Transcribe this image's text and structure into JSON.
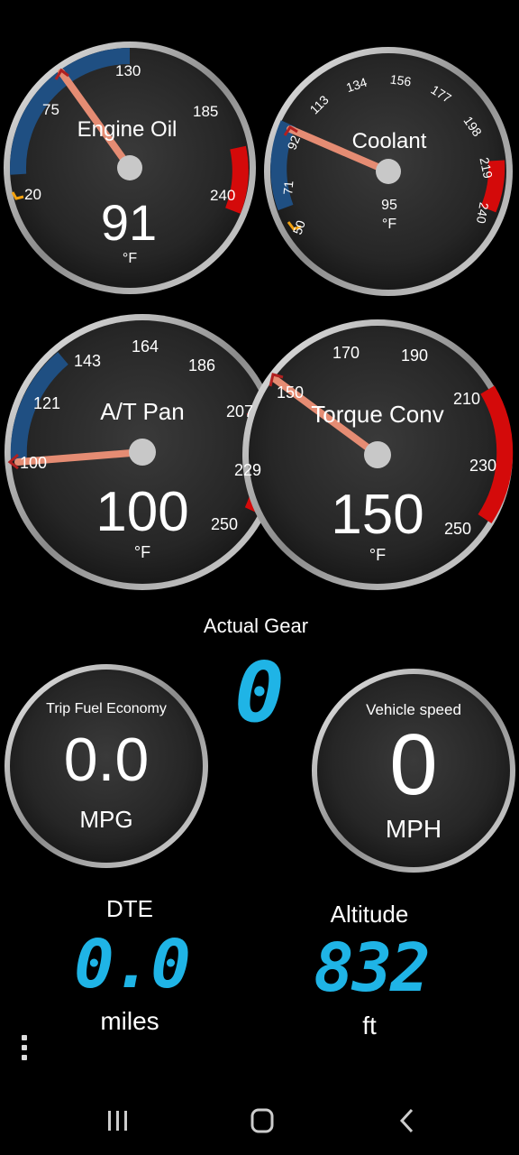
{
  "colors": {
    "accent_blue": "#1fb4e6",
    "band_blue": "#1f4f82",
    "band_red": "#d40a0a",
    "needle": "#e58c73"
  },
  "gauges": [
    {
      "id": "engine-oil",
      "title": "Engine Oil",
      "value": "91",
      "unit": "°F",
      "ticks": [
        "20",
        "75",
        "130",
        "185",
        "240"
      ],
      "min": 20,
      "max": 240,
      "needle_value": 70
    },
    {
      "id": "coolant",
      "title": "Coolant",
      "value": "95",
      "unit": "°F",
      "ticks": [
        "50",
        "71",
        "92",
        "113",
        "134",
        "156",
        "177",
        "198",
        "219",
        "240"
      ],
      "min": 50,
      "max": 240,
      "needle_value": 95
    },
    {
      "id": "at-pan",
      "title": "A/T Pan",
      "value": "100",
      "unit": "°F",
      "ticks": [
        "100",
        "121",
        "143",
        "164",
        "186",
        "207",
        "229",
        "250"
      ],
      "min": 100,
      "max": 250,
      "needle_value": 100
    },
    {
      "id": "torque-conv",
      "title": "Torque Conv",
      "value": "150",
      "unit": "°F",
      "ticks": [
        "150",
        "170",
        "190",
        "210",
        "230",
        "250"
      ],
      "min": 150,
      "max": 250,
      "needle_value": 150
    }
  ],
  "actual_gear": {
    "label": "Actual Gear",
    "value": "0"
  },
  "trip_fuel": {
    "title": "Trip Fuel Economy",
    "value": "0.0",
    "unit": "MPG"
  },
  "vehicle_speed": {
    "title": "Vehicle speed",
    "value": "0",
    "unit": "MPH"
  },
  "dte": {
    "label": "DTE",
    "value": "0.0",
    "unit": "miles"
  },
  "altitude": {
    "label": "Altitude",
    "value": "832",
    "unit": "ft"
  },
  "icons": {
    "menu": "vertical-dots-icon",
    "nav_recent": "recent-apps-icon",
    "nav_home": "home-icon",
    "nav_back": "back-icon"
  }
}
